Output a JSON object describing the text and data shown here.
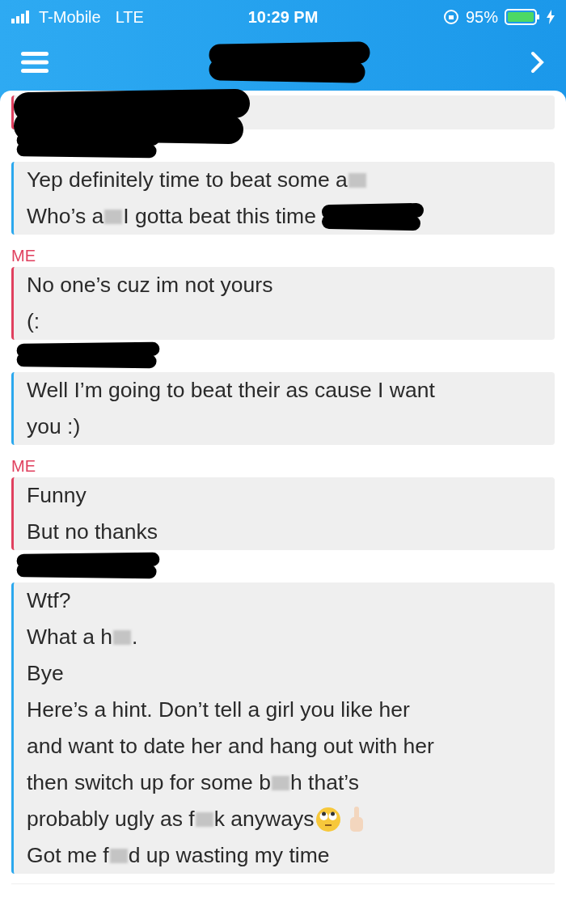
{
  "status_bar": {
    "carrier": "T-Mobile",
    "network": "LTE",
    "time": "10:29 PM",
    "battery": "95%"
  },
  "header": {
    "title_redacted": true
  },
  "groups": [
    {
      "outgoing": true,
      "label_redacted": false,
      "body_redacted": true
    },
    {
      "outgoing": false,
      "label_redacted": true,
      "body_redacted": false,
      "lines": [
        [
          {
            "kind": "text",
            "text": "Yep definitely time to beat some a"
          },
          {
            "kind": "blur"
          }
        ],
        [
          {
            "kind": "text",
            "text": "Who’s a"
          },
          {
            "kind": "blur"
          },
          {
            "kind": "text",
            "text": " I gotta beat this time"
          },
          {
            "kind": "scribble"
          }
        ]
      ]
    },
    {
      "outgoing": true,
      "label": "ME",
      "label_redacted": false,
      "body_redacted": false,
      "lines": [
        [
          {
            "kind": "text",
            "text": "No one’s cuz im not yours"
          }
        ],
        [
          {
            "kind": "text",
            "text": "(:"
          }
        ]
      ]
    },
    {
      "outgoing": false,
      "label_redacted": true,
      "body_redacted": false,
      "lines": [
        [
          {
            "kind": "text",
            "text": "Well I’m going to beat their as cause I want"
          }
        ],
        [
          {
            "kind": "text",
            "text": "you  :)"
          }
        ]
      ]
    },
    {
      "outgoing": true,
      "label": "ME",
      "label_redacted": false,
      "body_redacted": false,
      "lines": [
        [
          {
            "kind": "text",
            "text": "Funny"
          }
        ],
        [
          {
            "kind": "text",
            "text": "But no thanks"
          }
        ]
      ]
    },
    {
      "outgoing": false,
      "label_redacted": true,
      "body_redacted": false,
      "lines": [
        [
          {
            "kind": "text",
            "text": "Wtf?"
          }
        ],
        [
          {
            "kind": "text",
            "text": "What a h"
          },
          {
            "kind": "blur"
          },
          {
            "kind": "text",
            "text": "."
          }
        ],
        [
          {
            "kind": "text",
            "text": "Bye"
          }
        ],
        [
          {
            "kind": "text",
            "text": "Here’s a hint. Don’t tell a girl you like her"
          }
        ],
        [
          {
            "kind": "text",
            "text": "and want to date her and hang out with her"
          }
        ],
        [
          {
            "kind": "text",
            "text": "then switch up for some b"
          },
          {
            "kind": "blur"
          },
          {
            "kind": "text",
            "text": "h that’s"
          }
        ],
        [
          {
            "kind": "text",
            "text": "probably ugly as f"
          },
          {
            "kind": "blur"
          },
          {
            "kind": "text",
            "text": "k anyways"
          },
          {
            "kind": "eye-roll"
          },
          {
            "kind": "finger"
          }
        ],
        [
          {
            "kind": "text",
            "text": "Got me f"
          },
          {
            "kind": "blur"
          },
          {
            "kind": "text",
            "text": "d up wasting my time"
          }
        ]
      ]
    }
  ]
}
